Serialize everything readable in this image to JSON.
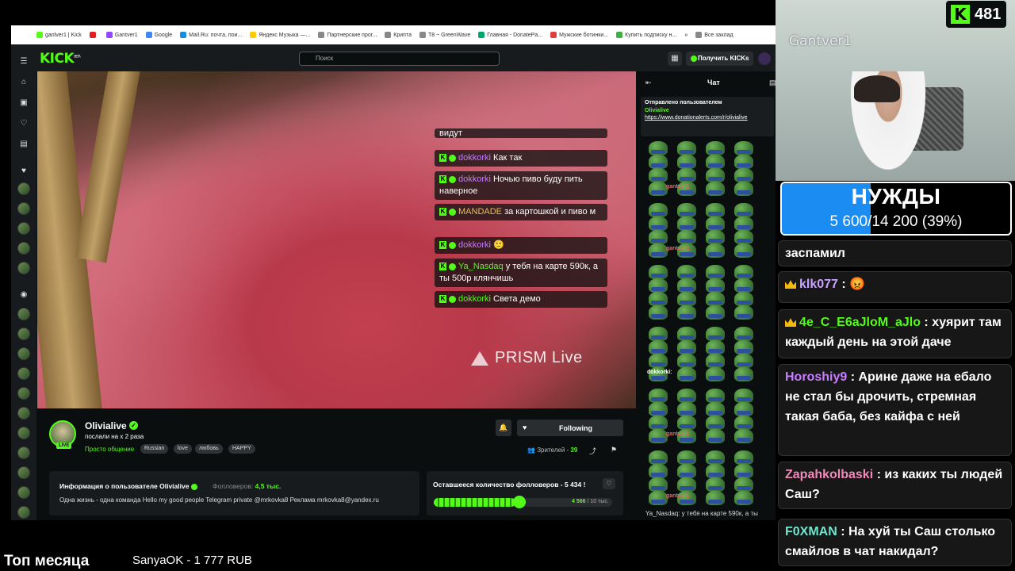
{
  "bookmarks": [
    "ganlver1 | Kick",
    "",
    "Gantver1",
    "Google",
    "Mail.Ru: почта, пои...",
    "Яндекс Музыка —...",
    "Партнерские прог...",
    "Крипта",
    "T8 ~ GreenWave",
    "Главная - DonatePa...",
    "Мужские ботинки...",
    "Купить подписку н...",
    "»",
    "Все заклад"
  ],
  "topbar": {
    "logo": "KICK",
    "logo_sup": "BETA",
    "search_placeholder": "Поиск",
    "kicks_button": "Получить KICKs"
  },
  "video_overlay_chat": [
    {
      "user": "",
      "text": "видут",
      "color": "#ffffff"
    },
    {
      "user": "dokkorki",
      "text": "Как так",
      "color": "#c77dff"
    },
    {
      "user": "dokkorki",
      "text": "Ночью пиво буду пить наверное",
      "color": "#c77dff"
    },
    {
      "user": "MANDADE",
      "text": "за картошкой и пиво м",
      "color": "#e6c04a"
    },
    {
      "user": "dokkorki",
      "text": "🙂",
      "color": "#c77dff"
    },
    {
      "user": "Ya_Nasdaq",
      "text": "у тебя на карте 590к, а ты 500р клянчишь",
      "color": "#53fc18"
    },
    {
      "user": "dokkorki",
      "text": "Света демо",
      "color": "#53fc18"
    }
  ],
  "video_watermark": "PRISM Live",
  "chat": {
    "title": "Чат",
    "pinned_header": "Отправлено пользователем",
    "pinned_user": "Olivialive",
    "pinned_link": "https://www.donationalerts.com/r/olivialive",
    "usernames": [
      "gantver1",
      "gantver1",
      "dokkorki:",
      "gantver1",
      "gantver1"
    ],
    "last_line": "Ya_Nasdaq: у тебя на карте 590к, а ты"
  },
  "channel": {
    "name": "Olivialive",
    "live": "LIVE",
    "title": "послали на х 2 раза",
    "category": "Просто общение",
    "tags": [
      "Russian",
      "love",
      "любовь",
      "HAPPY"
    ],
    "follow_button": "Following",
    "viewers_label": "Зрителей -",
    "viewers_count": "39"
  },
  "info": {
    "title": "Информация о пользователе Olivialive",
    "followers_label": "Фолловеров:",
    "followers_value": "4,5 тыс.",
    "bio": "Одна жизнь - одна команда Hello my good people   Telegram private @mrkovka8 Реклама mrkovka8@yandex.ru"
  },
  "goal": {
    "title": "Оставшееся количество фолловеров - 5 434 !",
    "current": "4 566",
    "target": "/ 10 тыс.",
    "progress_fraction": 0.457
  },
  "webcam": {
    "name": "Gantver1",
    "kick_count": "481"
  },
  "needs": {
    "title": "НУЖДЫ",
    "subtitle": "5 600/14 200 (39%)",
    "progress_fraction": 0.39
  },
  "stream_chat": [
    {
      "user": "",
      "text": "заспамил",
      "color": "#ffffff",
      "crown": false
    },
    {
      "user": "klk077",
      "text": "😡",
      "color": "#c9a3ff",
      "crown": true
    },
    {
      "user": "4e_C_E6aJloM_aJlo",
      "text": "хуярит там каждый день на этой даче",
      "color": "#53fc18",
      "crown": true
    },
    {
      "user": "Horoshiy9",
      "text": "Арине даже на ебало не стал бы дрочить, стремная такая баба, без кайфа с ней",
      "color": "#c77dff",
      "crown": false
    },
    {
      "user": "Zapahkolbaski",
      "text": "из каких ты людей Саш?",
      "color": "#f08ab8",
      "crown": false
    },
    {
      "user": "F0XMAN",
      "text": "На хуй ты Саш столько смайлов в чат накидал?",
      "color": "#6ee7d0",
      "crown": false
    }
  ],
  "bottom": {
    "top_month": "Топ месяца",
    "donor": "SanyaOK - 1 777 RUB"
  }
}
